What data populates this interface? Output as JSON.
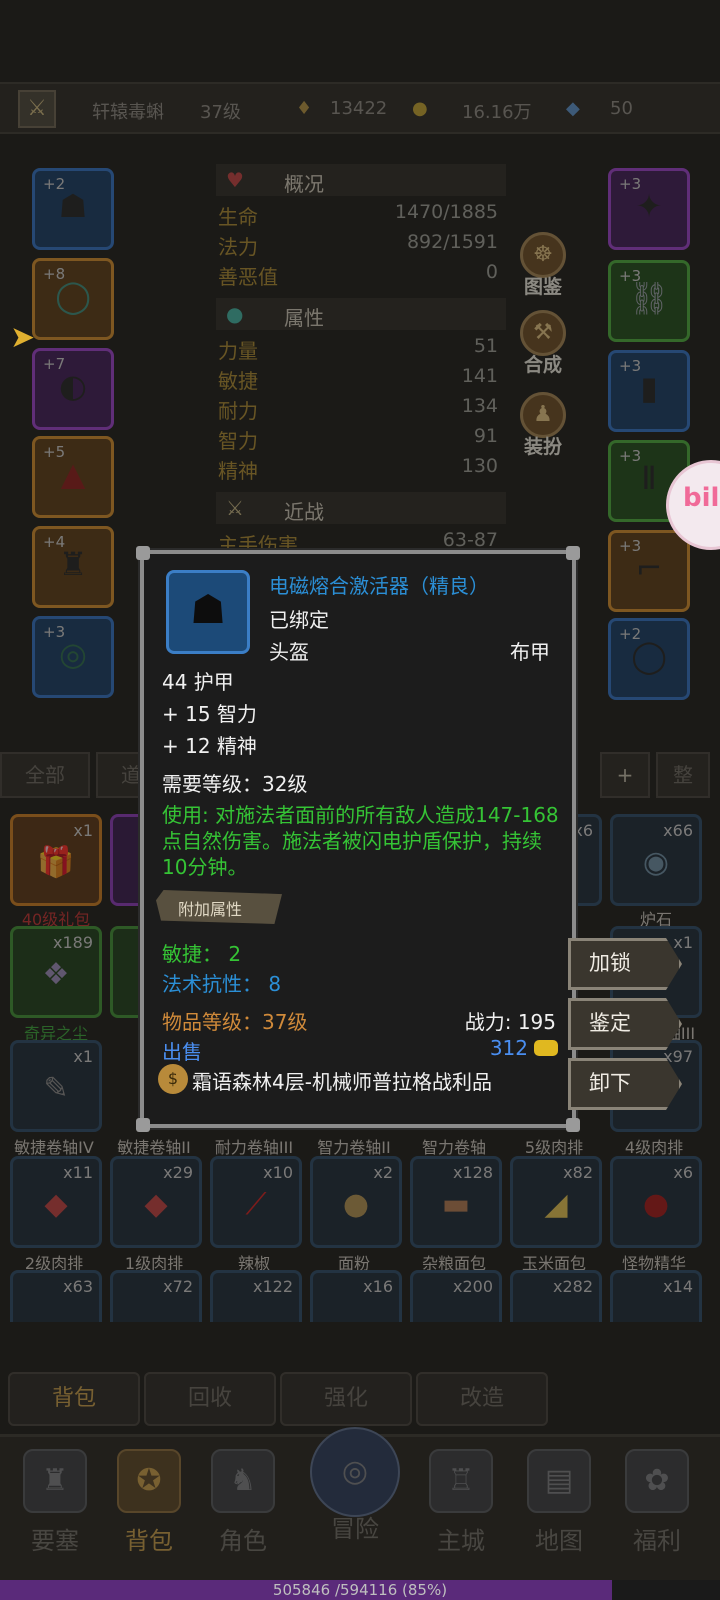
{
  "topbar": {
    "name": "轩辕毒蝌",
    "level": "37级",
    "honor": "13422",
    "gold": "16.16万",
    "diamonds": "50"
  },
  "equip_left": [
    {
      "level": "+2",
      "rarity": "blue",
      "icon": "helmet-icon"
    },
    {
      "level": "+8",
      "rarity": "orange",
      "icon": "necklace-icon"
    },
    {
      "level": "+7",
      "rarity": "purple",
      "icon": "shoulder-icon"
    },
    {
      "level": "+5",
      "rarity": "orange",
      "icon": "cloak-icon"
    },
    {
      "level": "+4",
      "rarity": "orange",
      "icon": "chest-armor-icon"
    },
    {
      "level": "+3",
      "rarity": "blue",
      "icon": "ring-icon"
    }
  ],
  "equip_right": [
    {
      "level": "+3",
      "rarity": "purple",
      "icon": "weapon-icon"
    },
    {
      "level": "+3",
      "rarity": "green",
      "icon": "chain-icon"
    },
    {
      "level": "+3",
      "rarity": "blue",
      "icon": "bracer-icon"
    },
    {
      "level": "+3",
      "rarity": "green",
      "icon": "leggings-icon"
    },
    {
      "level": "+3",
      "rarity": "orange",
      "icon": "boots-icon"
    },
    {
      "level": "+2",
      "rarity": "blue",
      "icon": "ring-icon"
    }
  ],
  "stats": {
    "overview": {
      "title": "概况",
      "rows": [
        {
          "k": "生命",
          "v": "1470/1885"
        },
        {
          "k": "法力",
          "v": "892/1591"
        },
        {
          "k": "善恶值",
          "v": "0"
        }
      ]
    },
    "attributes": {
      "title": "属性",
      "rows": [
        {
          "k": "力量",
          "v": "51"
        },
        {
          "k": "敏捷",
          "v": "141"
        },
        {
          "k": "耐力",
          "v": "134"
        },
        {
          "k": "智力",
          "v": "91"
        },
        {
          "k": "精神",
          "v": "130"
        }
      ]
    },
    "melee": {
      "title": "近战",
      "rows": [
        {
          "k": "主手伤害",
          "v": "63-87"
        }
      ]
    }
  },
  "side_buttons": {
    "codex": "图鉴",
    "craft": "合成",
    "outfit": "装扮"
  },
  "bili_badge": "bili",
  "categories": [
    "全部",
    "道具",
    "+",
    "整"
  ],
  "inventory": {
    "row1": [
      {
        "count": "x1",
        "label": "40级礼包",
        "rarity": "org",
        "icon": "gift-icon"
      },
      {
        "count": "x6",
        "label": "",
        "rarity": "",
        "icon": ""
      },
      {
        "count": "x66",
        "label": "炉石",
        "rarity": "",
        "icon": "hearthstone-icon"
      }
    ],
    "row2": [
      {
        "count": "x189",
        "label": "奇异之尘",
        "rarity": "grn",
        "icon": "dust-icon"
      },
      {
        "count": "x1",
        "label": "力量卷轴III",
        "rarity": "",
        "icon": ""
      }
    ],
    "row3": [
      {
        "count": "x1",
        "label": "敏捷卷轴IV",
        "icon": "scroll-icon"
      },
      {
        "count": "",
        "label": "敏捷卷轴II",
        "icon": ""
      },
      {
        "count": "",
        "label": "耐力卷轴III",
        "icon": ""
      },
      {
        "count": "",
        "label": "智力卷轴II",
        "icon": ""
      },
      {
        "count": "",
        "label": "智力卷轴",
        "icon": ""
      },
      {
        "count": "",
        "label": "5级肉排",
        "icon": ""
      },
      {
        "count": "x97",
        "label": "4级肉排",
        "icon": ""
      }
    ],
    "row4": [
      {
        "count": "x11",
        "label": "2级肉排",
        "icon": "meat-icon"
      },
      {
        "count": "x29",
        "label": "1级肉排",
        "icon": "meat-icon"
      },
      {
        "count": "x10",
        "label": "辣椒",
        "icon": "pepper-icon"
      },
      {
        "count": "x2",
        "label": "面粉",
        "icon": "flour-icon"
      },
      {
        "count": "x128",
        "label": "杂粮面包",
        "icon": "bread-icon"
      },
      {
        "count": "x82",
        "label": "玉米面包",
        "icon": "cheese-icon"
      },
      {
        "count": "x6",
        "label": "怪物精华",
        "icon": "blood-drop-icon"
      }
    ],
    "row5": [
      {
        "count": "x63",
        "label": "",
        "icon": "potion-icon"
      },
      {
        "count": "x72",
        "label": "",
        "icon": "potion-icon"
      },
      {
        "count": "x122",
        "label": "",
        "icon": "potion-icon"
      },
      {
        "count": "x16",
        "label": "",
        "icon": "potion-icon"
      },
      {
        "count": "x200",
        "label": "",
        "icon": "potion-icon"
      },
      {
        "count": "x282",
        "label": "",
        "icon": "potion-icon"
      },
      {
        "count": "x14",
        "label": "",
        "icon": "potion-icon"
      }
    ]
  },
  "tooltip": {
    "name": "电磁熔合激活器（精良）",
    "bound": "已绑定",
    "slot": "头盔",
    "type": "布甲",
    "armor": "44 护甲",
    "bonus1": "+ 15 智力",
    "bonus2": "+ 12 精神",
    "req_level": "需要等级：32级",
    "use_text": "使用: 对施法者面前的所有敌人造成147-168点自然伤害。施法者被闪电护盾保护，持续10分钟。",
    "extra_title": "附加属性",
    "agi": "敏捷： 2",
    "res": "法术抗性： 8",
    "item_level": "物品等级：37级",
    "power": "战力: 195",
    "sell_label": "出售",
    "sell_price": "312",
    "source": "霜语森林4层-机械师普拉格战利品"
  },
  "actions": {
    "lock": "加锁",
    "appraise": "鉴定",
    "unequip": "卸下"
  },
  "bottom_tabs": [
    "背包",
    "回收",
    "强化",
    "改造"
  ],
  "nav": [
    {
      "label": "要塞",
      "icon": "fortress-icon"
    },
    {
      "label": "背包",
      "icon": "backpack-icon",
      "active": true
    },
    {
      "label": "角色",
      "icon": "character-icon"
    },
    {
      "label": "冒险",
      "icon": "portal-icon"
    },
    {
      "label": "主城",
      "icon": "castle-icon"
    },
    {
      "label": "地图",
      "icon": "map-icon"
    },
    {
      "label": "福利",
      "icon": "gift-bag-icon"
    }
  ],
  "xp": {
    "text": "505846 /594116 (85%)",
    "fraction": 0.85
  }
}
